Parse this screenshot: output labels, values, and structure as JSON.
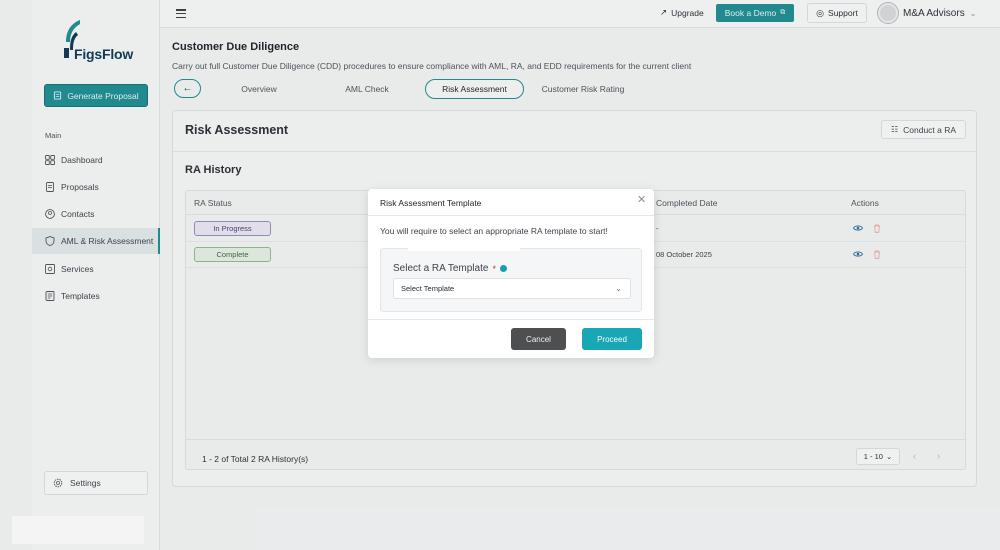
{
  "sidebar": {
    "logo_text": "FigsFlow",
    "generate_label": "Generate Proposal",
    "section_label": "Main",
    "items": [
      {
        "label": "Dashboard",
        "icon": "grid-icon"
      },
      {
        "label": "Proposals",
        "icon": "document-icon"
      },
      {
        "label": "Contacts",
        "icon": "user-circle-icon"
      },
      {
        "label": "AML & Risk Assessment",
        "icon": "shield-icon",
        "active": true
      },
      {
        "label": "Services",
        "icon": "services-icon"
      },
      {
        "label": "Templates",
        "icon": "template-icon"
      }
    ],
    "settings_label": "Settings"
  },
  "topbar": {
    "upgrade_label": "Upgrade",
    "demo_label": "Book a Demo",
    "support_label": "Support",
    "account_name": "M&A Advisors"
  },
  "header": {
    "title": "Customer Due Diligence",
    "description": "Carry out full Customer Due Diligence (CDD) procedures to ensure compliance with AML, RA, and EDD requirements for the current client",
    "tabs": [
      {
        "label": "Overview"
      },
      {
        "label": "AML Check"
      },
      {
        "label": "Risk Assessment",
        "active": true
      },
      {
        "label": "Customer Risk Rating"
      }
    ]
  },
  "main": {
    "title": "Risk Assessment",
    "conduct_label": "Conduct a RA",
    "history_title": "RA History",
    "columns": [
      "RA Status",
      "Completed Date",
      "Actions"
    ],
    "rows": [
      {
        "status": "In Progress",
        "completed": "-"
      },
      {
        "status": "Complete",
        "completed": "08 October 2025"
      }
    ],
    "pager_text": "1 - 2 of Total 2 RA History(s)",
    "per_page": "1 - 10"
  },
  "modal": {
    "title": "Risk Assessment Template",
    "message": "You will require to select an appropriate RA template to start!",
    "field_label": "Select a RA Template",
    "required_mark": "*",
    "select_value": "Select Template",
    "cancel_label": "Cancel",
    "proceed_label": "Proceed"
  },
  "colors": {
    "brand": "#1f8f93",
    "proceed": "#19a7b5",
    "cancel": "#4d4f51"
  }
}
